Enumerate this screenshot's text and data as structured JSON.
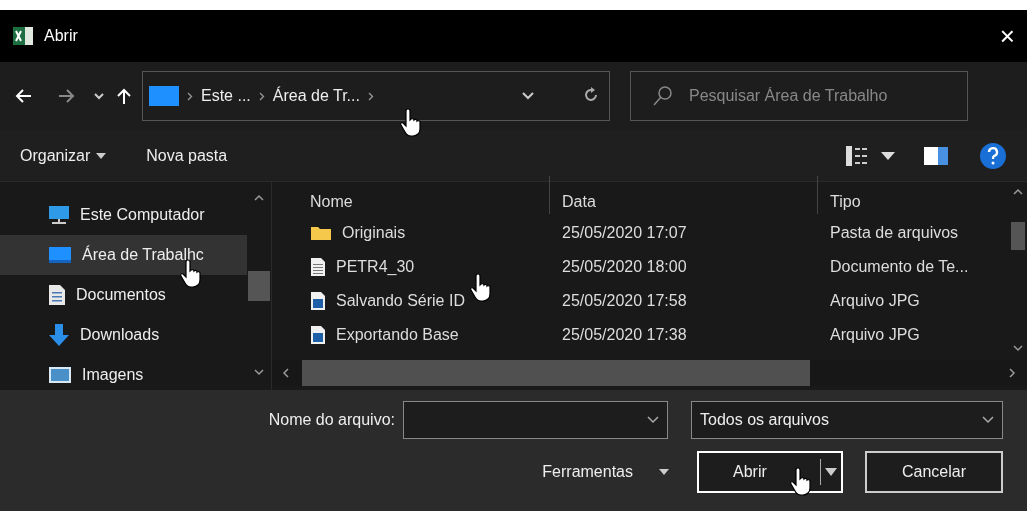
{
  "window": {
    "title": "Abrir",
    "close": "×"
  },
  "address": {
    "crumbs": [
      "Este ...",
      "Área de Tr..."
    ]
  },
  "search": {
    "placeholder": "Pesquisar Área de Trabalho"
  },
  "toolbar": {
    "buttons": [
      "Organizar",
      "Nova pasta"
    ]
  },
  "sidebar": {
    "items": [
      {
        "label": "Este Computador",
        "kind": "computer",
        "selected": false
      },
      {
        "label": "Área de Trabalhc",
        "kind": "desktop",
        "selected": true
      },
      {
        "label": "Documentos",
        "kind": "documents",
        "selected": false
      },
      {
        "label": "Downloads",
        "kind": "downloads",
        "selected": false
      },
      {
        "label": "Imagens",
        "kind": "pictures",
        "selected": false
      }
    ]
  },
  "table": {
    "columns": [
      "Nome",
      "Data",
      "Tipo"
    ],
    "rows": [
      {
        "name": "Originais",
        "kind": "folder",
        "date": "25/05/2020 17:07",
        "type": "Pasta de arquivos"
      },
      {
        "name": "PETR4_30",
        "kind": "text",
        "date": "25/05/2020 18:00",
        "type": "Documento de Te..."
      },
      {
        "name": "Salvando Série ID",
        "kind": "image",
        "date": "25/05/2020 17:58",
        "type": "Arquivo JPG"
      },
      {
        "name": "Exportando Base",
        "kind": "image",
        "date": "25/05/2020 17:38",
        "type": "Arquivo JPG"
      }
    ]
  },
  "footer": {
    "filename_label": "Nome do arquivo:",
    "filter": "Todos os arquivos",
    "tools": "Ferramentas",
    "open": "Abrir",
    "cancel": "Cancelar"
  }
}
